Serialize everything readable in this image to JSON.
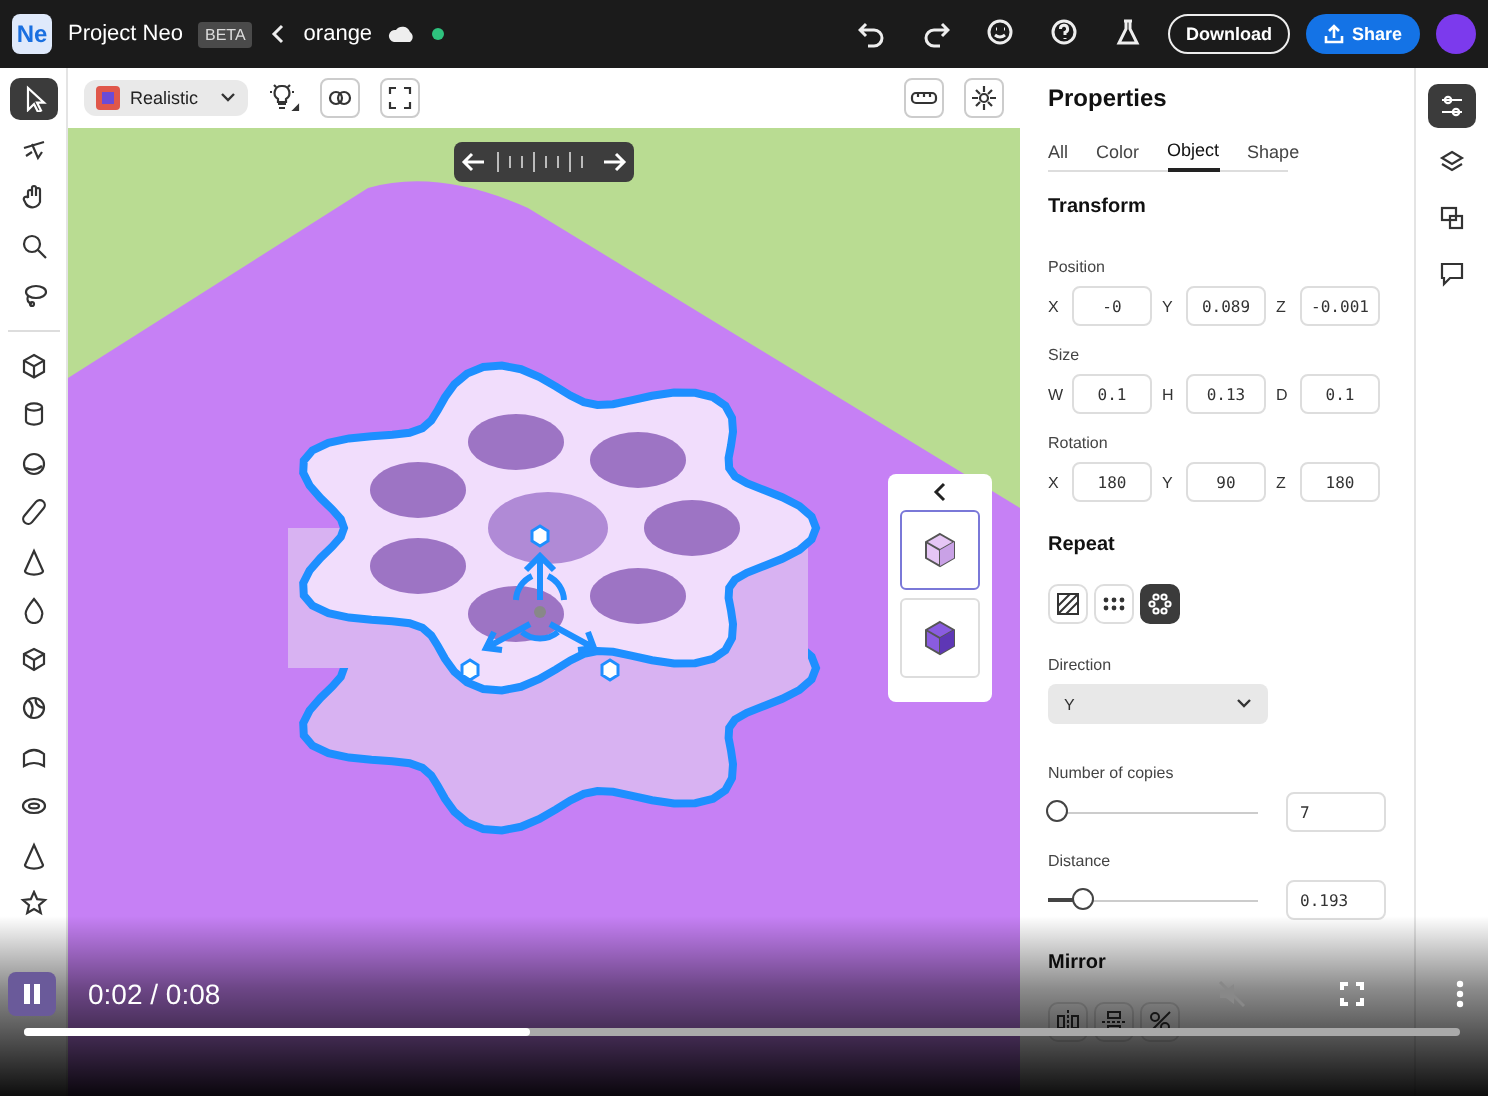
{
  "header": {
    "logo": "Ne",
    "app_name": "Project Neo",
    "badge": "BETA",
    "file_name": "orange",
    "download": "Download",
    "share": "Share"
  },
  "tool_groups": [
    [
      {
        "selected": true
      },
      {
        "selected": false
      },
      {
        "selected": false
      },
      {
        "selected": false
      },
      {
        "selected": false
      }
    ],
    [
      {
        "selected": false
      },
      {
        "selected": false
      },
      {
        "selected": false
      },
      {
        "selected": false
      },
      {
        "selected": false
      },
      {
        "selected": false
      },
      {
        "selected": false
      },
      {
        "selected": false
      },
      {
        "selected": false
      },
      {
        "selected": false
      },
      {
        "selected": false
      },
      {
        "selected": false
      }
    ]
  ],
  "canvas_toolbar": {
    "render_mode": "Realistic"
  },
  "materials": [
    {
      "selected": true
    },
    {
      "selected": false
    }
  ],
  "properties": {
    "title": "Properties",
    "tabs": [
      {
        "label": "All",
        "selected": false
      },
      {
        "label": "Color",
        "selected": false
      },
      {
        "label": "Object",
        "selected": true
      },
      {
        "label": "Shape",
        "selected": false
      }
    ],
    "transform": {
      "title": "Transform",
      "groups": [
        {
          "label": "Position",
          "fields": [
            {
              "axis": "X",
              "value": "-0"
            },
            {
              "axis": "Y",
              "value": "0.089"
            },
            {
              "axis": "Z",
              "value": "-0.001"
            }
          ]
        },
        {
          "label": "Size",
          "fields": [
            {
              "axis": "W",
              "value": "0.1"
            },
            {
              "axis": "H",
              "value": "0.13"
            },
            {
              "axis": "D",
              "value": "0.1"
            }
          ]
        },
        {
          "label": "Rotation",
          "fields": [
            {
              "axis": "X",
              "value": "180"
            },
            {
              "axis": "Y",
              "value": "90"
            },
            {
              "axis": "Z",
              "value": "180"
            }
          ]
        }
      ]
    },
    "repeat": {
      "title": "Repeat",
      "modes": [
        {
          "selected": false
        },
        {
          "selected": false
        },
        {
          "selected": true
        }
      ],
      "direction": {
        "label": "Direction",
        "value": "Y"
      },
      "sliders": [
        {
          "label": "Number of copies",
          "level": 0.04,
          "value": "7"
        },
        {
          "label": "Distance",
          "level": 0.16,
          "value": "0.193"
        }
      ]
    },
    "mirror": {
      "title": "Mirror"
    }
  },
  "rail": [
    {
      "selected": true
    },
    {
      "selected": false
    },
    {
      "selected": false
    },
    {
      "selected": false
    }
  ],
  "video": {
    "playing": true,
    "time": "0:02 / 0:08",
    "progress": {
      "level": 0.352
    }
  }
}
